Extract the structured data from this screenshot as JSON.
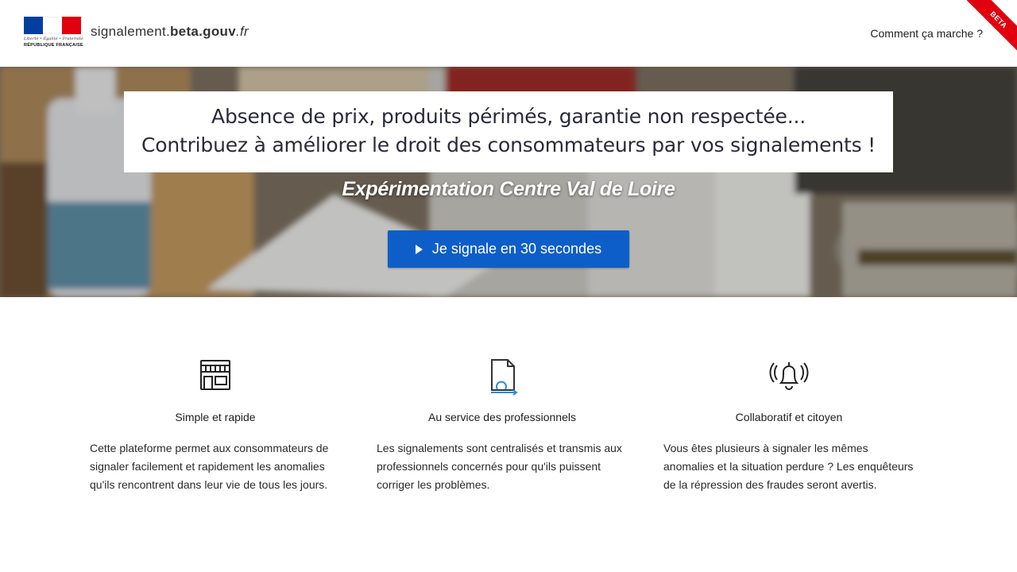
{
  "header": {
    "motto": "Liberté • Égalité • Fraternité",
    "republique": "RÉPUBLIQUE FRANÇAISE",
    "site_name_part1": "signalement.",
    "site_name_part2": "beta.gouv",
    "site_name_part3": ".fr",
    "nav_link": "Comment ça marche ?",
    "beta_label": "BETA"
  },
  "hero": {
    "headline_line1": "Absence de prix, produits périmés, garantie non respectée...",
    "headline_line2": "Contribuez à améliorer le droit des consommateurs par vos signalements !",
    "subtitle": "Expérimentation Centre Val de Loire",
    "cta_label": "Je signale en 30 secondes"
  },
  "features": [
    {
      "icon": "store-icon",
      "title": "Simple et rapide",
      "description": "Cette plateforme permet aux consommateurs de signaler facilement et rapidement les anomalies qu'ils rencontrent dans leur vie de tous les jours."
    },
    {
      "icon": "document-refresh-icon",
      "title": "Au service des professionnels",
      "description": "Les signalements sont centralisés et transmis aux professionnels concernés pour qu'ils puissent corriger les problèmes."
    },
    {
      "icon": "bell-alert-icon",
      "title": "Collaboratif et citoyen",
      "description": "Vous êtes plusieurs à signaler les mêmes anomalies et la situation perdure ? Les enquêteurs de la répression des fraudes seront avertis."
    }
  ],
  "colors": {
    "primary_button": "#0d5ec9",
    "flag_blue": "#003f9e",
    "flag_red": "#e1000f",
    "beta_ribbon": "#e1000f"
  }
}
